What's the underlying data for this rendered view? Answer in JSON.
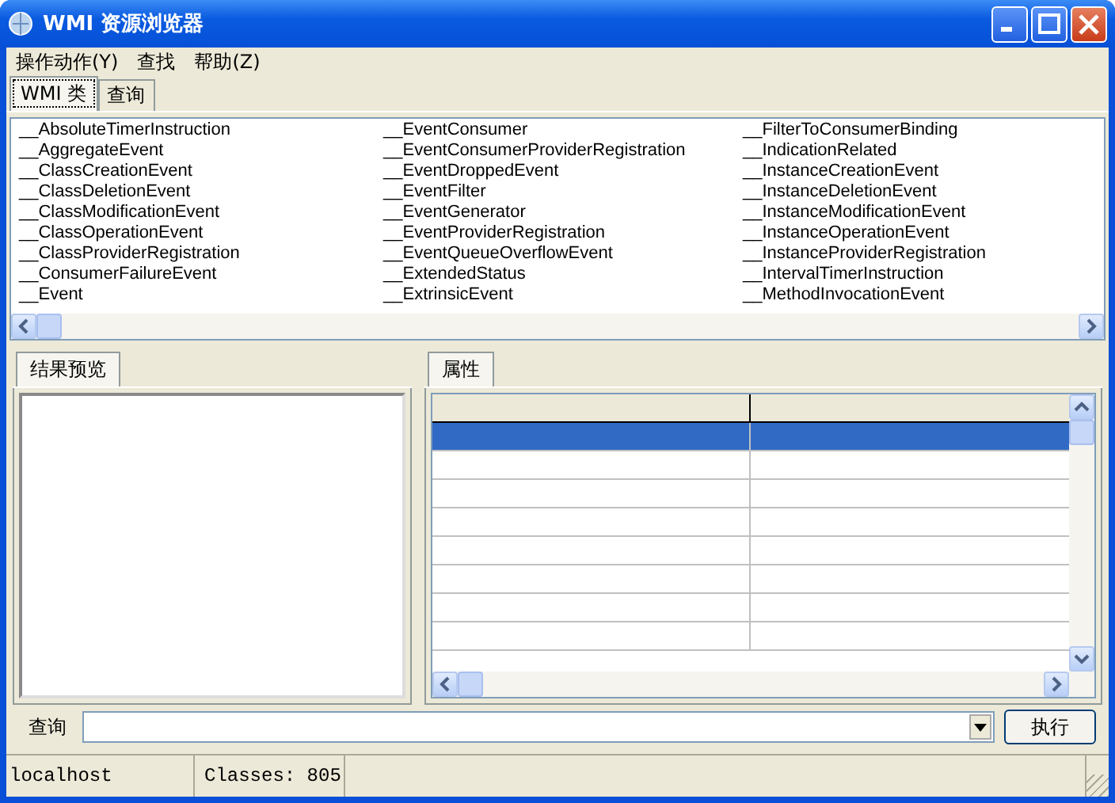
{
  "window": {
    "title": "WMI 资源浏览器"
  },
  "menu": [
    {
      "label": "操作动作(Y)"
    },
    {
      "label": "查找"
    },
    {
      "label": "帮助(Z)"
    }
  ],
  "tabs": [
    {
      "label": "WMI 类",
      "selected": true
    },
    {
      "label": "查询",
      "selected": false
    }
  ],
  "class_list": {
    "columns": [
      [
        "__AbsoluteTimerInstruction",
        "__AggregateEvent",
        "__ClassCreationEvent",
        "__ClassDeletionEvent",
        "__ClassModificationEvent",
        "__ClassOperationEvent",
        "__ClassProviderRegistration",
        "__ConsumerFailureEvent",
        "__Event"
      ],
      [
        "__EventConsumer",
        "__EventConsumerProviderRegistration",
        "__EventDroppedEvent",
        "__EventFilter",
        "__EventGenerator",
        "__EventProviderRegistration",
        "__EventQueueOverflowEvent",
        "__ExtendedStatus",
        "__ExtrinsicEvent"
      ],
      [
        "__FilterToConsumerBinding",
        "__IndicationRelated",
        "__InstanceCreationEvent",
        "__InstanceDeletionEvent",
        "__InstanceModificationEvent",
        "__InstanceOperationEvent",
        "__InstanceProviderRegistration",
        "__IntervalTimerInstruction",
        "__MethodInvocationEvent"
      ]
    ]
  },
  "results_panel": {
    "tab": "结果预览"
  },
  "properties_panel": {
    "tab": "属性",
    "rows": [
      {
        "selected": true
      },
      {
        "selected": false
      },
      {
        "selected": false
      },
      {
        "selected": false
      },
      {
        "selected": false
      },
      {
        "selected": false
      },
      {
        "selected": false
      },
      {
        "selected": false
      }
    ]
  },
  "query_bar": {
    "label": "查询",
    "button": "执行"
  },
  "status_bar": [
    "localhost",
    "Classes: 805"
  ]
}
